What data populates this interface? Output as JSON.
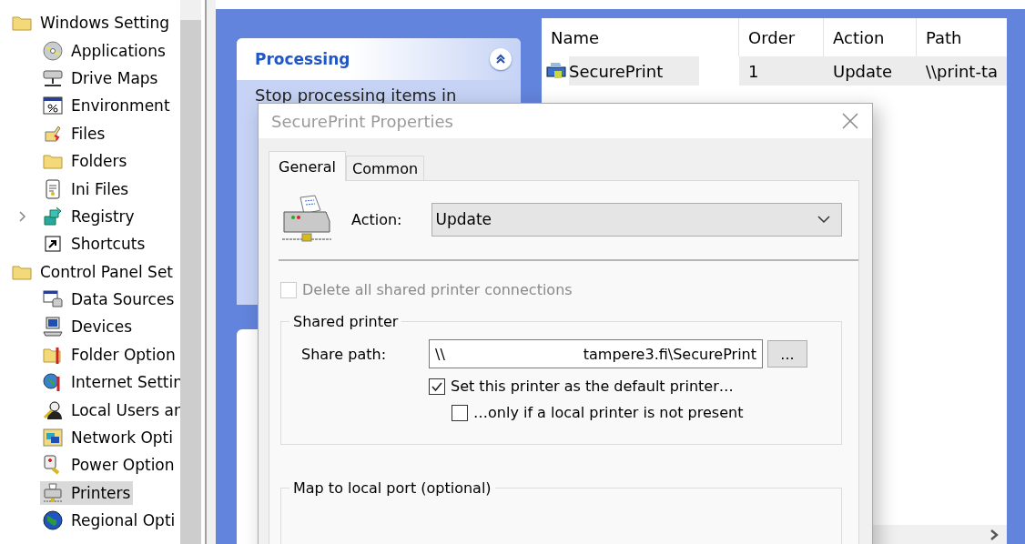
{
  "tree": [
    {
      "label": "Windows Setting",
      "selected": false,
      "children": [
        {
          "label": "Applications",
          "selected": false
        },
        {
          "label": "Drive Maps",
          "selected": false
        },
        {
          "label": "Environment",
          "selected": false
        },
        {
          "label": "Files",
          "selected": false
        },
        {
          "label": "Folders",
          "selected": false
        },
        {
          "label": "Ini Files",
          "selected": false
        },
        {
          "label": "Registry",
          "selected": false,
          "expanded": false
        },
        {
          "label": "Shortcuts",
          "selected": false
        }
      ]
    },
    {
      "label": "Control Panel Set",
      "selected": false,
      "children": [
        {
          "label": "Data Sources",
          "selected": false
        },
        {
          "label": "Devices",
          "selected": false
        },
        {
          "label": "Folder Option",
          "selected": false
        },
        {
          "label": "Internet Settin",
          "selected": false
        },
        {
          "label": "Local Users ar",
          "selected": false
        },
        {
          "label": "Network Opti",
          "selected": false
        },
        {
          "label": "Power Option",
          "selected": false
        },
        {
          "label": "Printers",
          "selected": true
        },
        {
          "label": "Regional Opti",
          "selected": false
        }
      ]
    }
  ],
  "task_pane": {
    "title": "Processing",
    "expanded": true,
    "text": "Stop processing items in"
  },
  "table": {
    "columns": [
      "Name",
      "Order",
      "Action",
      "Path"
    ],
    "rows": [
      {
        "cells": [
          "SecurePrint",
          "1",
          "Update",
          "\\\\print-ta"
        ],
        "selected": true
      }
    ]
  },
  "dialog": {
    "title": "SecurePrint Properties",
    "tabs": [
      {
        "label": "General",
        "selected": true
      },
      {
        "label": "Common",
        "selected": false
      }
    ],
    "action": {
      "label": "Action:",
      "value": "Update"
    },
    "delete_all": {
      "label": "Delete all shared printer connections",
      "checked": false,
      "disabled": true
    },
    "shared_printer": {
      "title": "Shared printer",
      "share_path": {
        "label": "Share path:",
        "visible_parts": [
          "\\\\",
          "tampere3.fi\\SecurePrint"
        ]
      },
      "browse_button": "...",
      "default_printer": {
        "label": "Set this printer as the default printer…",
        "checked": true
      },
      "only_if_no_local": {
        "label": "…only if a local printer is not present",
        "checked": false
      }
    },
    "map_port": {
      "title": "Map to local port (optional)"
    }
  }
}
